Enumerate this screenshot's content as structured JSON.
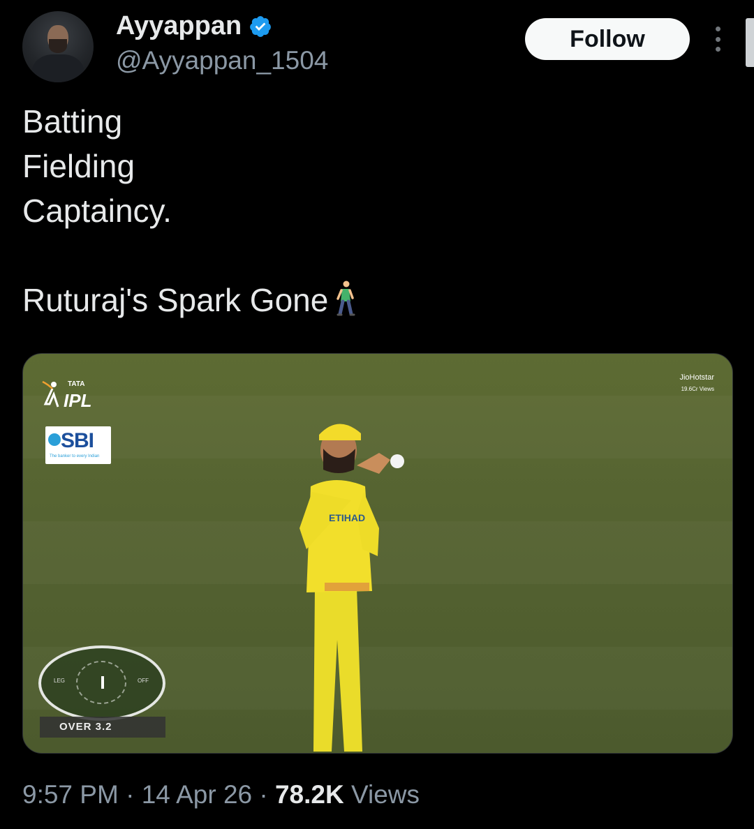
{
  "author": {
    "display_name": "Ayyappan",
    "handle": "@Ayyappan_1504",
    "verified": true
  },
  "actions": {
    "follow_label": "Follow"
  },
  "tweet": {
    "lines": [
      "Batting",
      "Fielding",
      "Captaincy.",
      "",
      "Ruturaj's Spark Gone"
    ],
    "emoji": "person-walking-icon"
  },
  "media": {
    "logo_tata": "TATA",
    "logo_ipl": "IPL",
    "sponsor": "SBI",
    "sponsor_tagline": "The banker to every Indian",
    "broadcaster": "JioHotstar",
    "broadcaster_views": "19.6Cr Views",
    "field_leg": "LEG",
    "field_off": "OFF",
    "over_text": "OVER 3.2"
  },
  "meta": {
    "time": "9:57 PM",
    "separator": "·",
    "date": "14 Apr 26",
    "views_count": "78.2K",
    "views_label": "Views"
  },
  "colors": {
    "background": "#000000",
    "text_primary": "#e7e9ea",
    "text_secondary": "#8b98a5",
    "verified_blue": "#1d9bf0",
    "jersey_yellow": "#f2df2b"
  }
}
